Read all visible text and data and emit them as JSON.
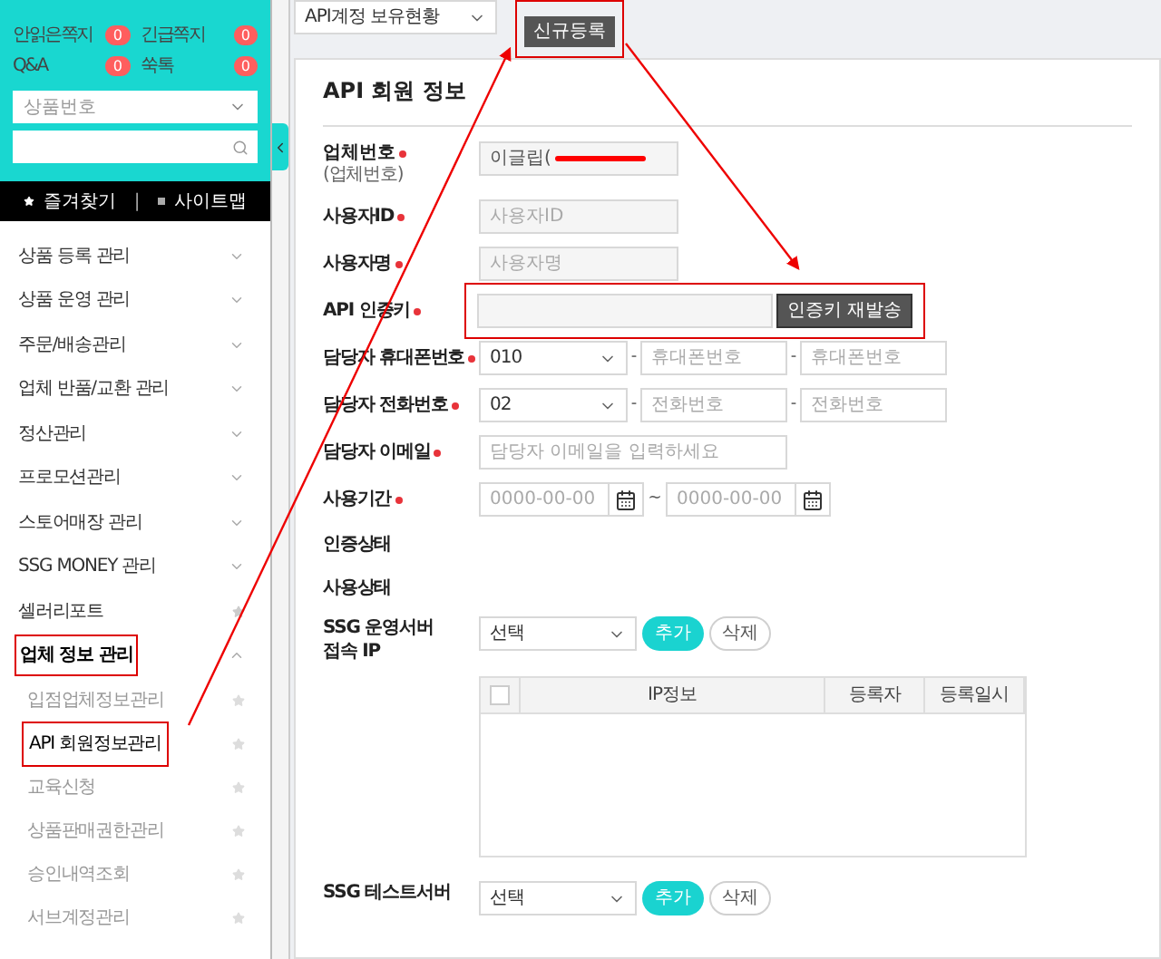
{
  "sidebar": {
    "counters": [
      {
        "label": "안읽은쪽지",
        "count": "0"
      },
      {
        "label": "긴급쪽지",
        "count": "0"
      },
      {
        "label": "Q&A",
        "count": "0"
      },
      {
        "label": "쑥톡",
        "count": "0"
      }
    ],
    "product_select": {
      "placeholder": "상품번호"
    },
    "shortcuts": [
      {
        "label": "즐겨찾기"
      },
      {
        "label": "사이트맵"
      }
    ],
    "separator": "|",
    "items": [
      {
        "label": "상품 등록 관리",
        "kind": "group",
        "expanded": false
      },
      {
        "label": "상품 운영 관리",
        "kind": "group",
        "expanded": false
      },
      {
        "label": "주문/배송관리",
        "kind": "group",
        "expanded": false
      },
      {
        "label": "업체 반품/교환 관리",
        "kind": "group",
        "expanded": false
      },
      {
        "label": "정산관리",
        "kind": "group",
        "expanded": false
      },
      {
        "label": "프로모션관리",
        "kind": "group",
        "expanded": false
      },
      {
        "label": "스토어매장 관리",
        "kind": "group",
        "expanded": false
      },
      {
        "label": "SSG MONEY 관리",
        "kind": "group",
        "expanded": false
      },
      {
        "label": "셀러리포트",
        "kind": "link"
      },
      {
        "label": "업체 정보 관리",
        "kind": "group",
        "expanded": true,
        "children": [
          {
            "label": "입점업체정보관리",
            "selected": false
          },
          {
            "label": "API 회원정보관리",
            "selected": true
          },
          {
            "label": "교육신청",
            "selected": false
          },
          {
            "label": "상품판매권한관리",
            "selected": false
          },
          {
            "label": "승인내역조회",
            "selected": false
          },
          {
            "label": "서브계정관리",
            "selected": false
          }
        ]
      }
    ]
  },
  "toolbar": {
    "account_select": {
      "value": "API계정 보유현황"
    },
    "new_button": "신규등록"
  },
  "form": {
    "title": "API 회원 정보",
    "company": {
      "label": "업체번호",
      "sublabel": "(업체번호)",
      "value": "이글립(",
      "required": true
    },
    "user_id": {
      "label": "사용자ID",
      "placeholder": "사용자ID",
      "required": true
    },
    "user_name": {
      "label": "사용자명",
      "placeholder": "사용자명",
      "required": true
    },
    "api_key": {
      "label": "API 인증키",
      "button": "인증키 재발송",
      "required": true
    },
    "mobile": {
      "label": "담당자 휴대폰번호",
      "prefix": "010",
      "placeholders": [
        "휴대폰번호",
        "휴대폰번호"
      ],
      "dash": "-",
      "required": true
    },
    "phone": {
      "label": "담당자 전화번호",
      "prefix": "02",
      "placeholders": [
        "전화번호",
        "전화번호"
      ],
      "dash": "-",
      "required": true
    },
    "email": {
      "label": "담당자 이메일",
      "placeholder": "담당자 이메일을 입력하세요",
      "required": true
    },
    "period": {
      "label": "사용기간",
      "placeholders": [
        "0000-00-00",
        "0000-00-00"
      ],
      "tilde": "~",
      "required": true
    },
    "auth_status": {
      "label": "인증상태"
    },
    "use_status": {
      "label": "사용상태"
    },
    "prod_server": {
      "label": "SSG 운영서버\n접속 IP",
      "select": "선택",
      "add": "추가",
      "delete": "삭제",
      "table": {
        "columns": [
          "IP정보",
          "등록자",
          "등록일시"
        ],
        "all_checked": false
      }
    },
    "test_server": {
      "label": "SSG 테스트서버",
      "select": "선택",
      "add": "추가",
      "delete": "삭제"
    }
  }
}
